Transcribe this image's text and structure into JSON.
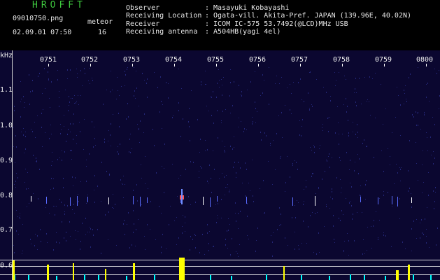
{
  "header": {
    "brand": "HROFFT",
    "filename": "09010750.png",
    "datetime": "02.09.01 07:50",
    "meteor_label": "meteor",
    "meteor_count": "16",
    "rows": [
      {
        "label": "Observer",
        "value": ": Masayuki Kobayashi"
      },
      {
        "label": "Receiving Location",
        "value": ": Ogata-vill. Akita-Pref. JAPAN (139.96E, 40.02N)"
      },
      {
        "label": "Receiver",
        "value": ": ICOM IC-575 53.7492(@LCD)MHz USB"
      },
      {
        "label": "Receiving antenna",
        "value": ": A504HB(yagi 4el)"
      }
    ]
  },
  "plot": {
    "y_unit": "kHz",
    "time_labels": [
      "0751",
      "0752",
      "0753",
      "0754",
      "0755",
      "0756",
      "0757",
      "0758",
      "0759",
      "0800"
    ],
    "freq_labels": [
      "1.1",
      "1.0",
      "0.9",
      "0.8",
      "0.7",
      "0.6"
    ],
    "colors": {
      "background": "#0b0730",
      "echo": "#ff5050",
      "peak": "#ffff00",
      "noise": "#00ffff"
    }
  }
}
